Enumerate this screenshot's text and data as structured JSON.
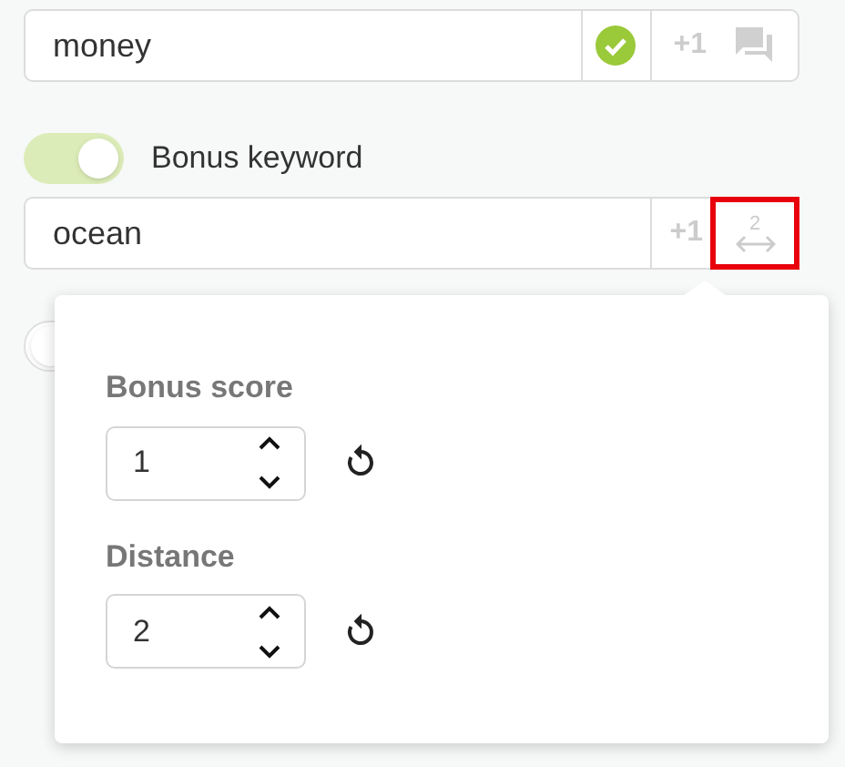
{
  "keyword_row": {
    "value": "money",
    "verified": true,
    "score": "+1"
  },
  "bonus_toggle": {
    "label": "Bonus keyword",
    "on": true
  },
  "bonus_row": {
    "value": "ocean",
    "score": "+1",
    "distance_badge": "2",
    "highlighted": true
  },
  "next_toggle": {
    "on": false
  },
  "popover": {
    "fields": [
      {
        "label": "Bonus score",
        "value": "1"
      },
      {
        "label": "Distance",
        "value": "2"
      }
    ]
  }
}
